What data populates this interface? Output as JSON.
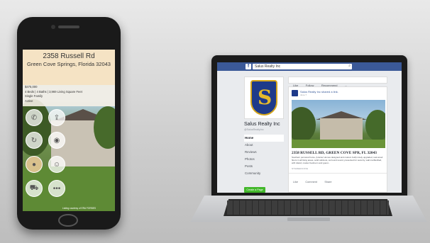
{
  "phone": {
    "listing": {
      "street": "2358 Russell Rd",
      "city": "Green Cove Springs, Florida 32043",
      "price": "$475,000",
      "specs": "4 Beds | 4 Baths | 3,969 Living Square Feet",
      "type": "Single Family",
      "status": "Active"
    },
    "buttons": [
      {
        "icon": "phone-icon"
      },
      {
        "icon": "share-icon"
      },
      {
        "icon": "refresh-icon"
      },
      {
        "icon": "camera-icon"
      },
      {
        "icon": "coin-icon"
      },
      {
        "icon": "agent-icon"
      },
      {
        "icon": "car-icon"
      },
      {
        "icon": "more-icon",
        "glyph": "•••"
      }
    ],
    "credit": "Listing courtesy of ERA FORBES"
  },
  "facebook": {
    "search_text": "Salus Realty Inc",
    "page_name": "Salus Realty Inc",
    "page_handle": "@SalusRealtyInc",
    "nav": [
      "Home",
      "About",
      "Reviews",
      "Photos",
      "Posts",
      "Community"
    ],
    "create_page": "Create a Page",
    "actions": [
      "Like",
      "Follow",
      "Recommend",
      "..."
    ],
    "post": {
      "author": "Salus Realty Inc shared a link.",
      "time": "June 7",
      "title": "2358 RUSSELL RD, GREEN COVE SPR, FL 32043",
      "body": "Southern personal home, (Hunter Homes designed and custom built) nicely upgraded, real wood floors in all living areas, solid cabinets, surround sound, presented for security, wall marble/tiled, with island, master bedroom and guest...",
      "count": "NTGREENCOVE",
      "actions": [
        "Like",
        "Comment",
        "Share"
      ]
    }
  },
  "colors": {
    "fb_blue": "#3b5998",
    "shield_blue": "#1e3a8a",
    "shield_gold": "#e5b92b",
    "create_green": "#42b72a"
  }
}
